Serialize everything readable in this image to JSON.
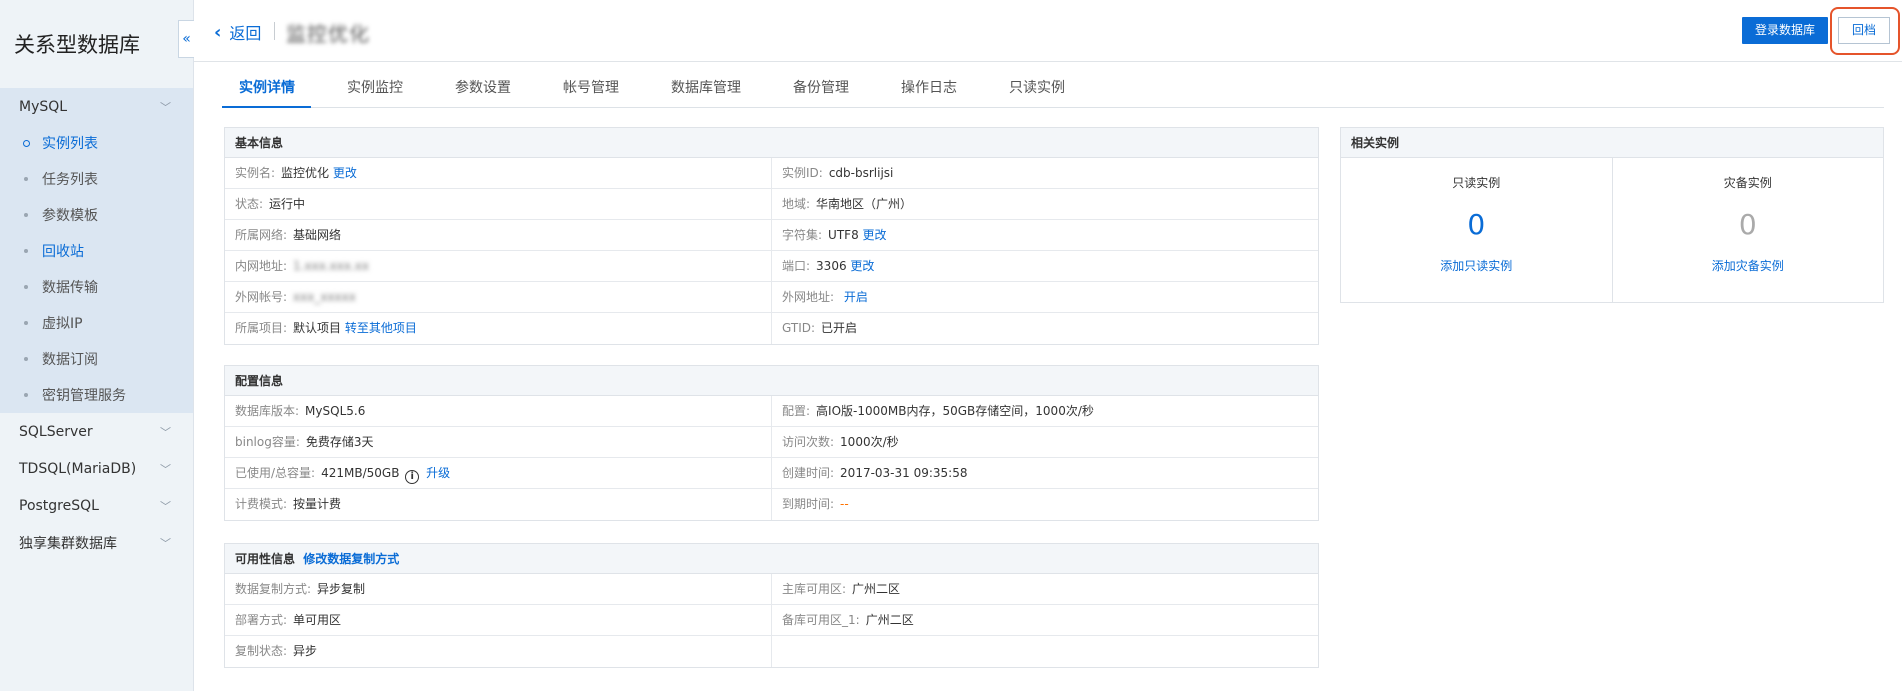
{
  "sidebar": {
    "title": "关系型数据库",
    "collapse_icon": "«",
    "groups": [
      {
        "label": "MySQL",
        "items": [
          "实例列表",
          "任务列表",
          "参数模板",
          "回收站",
          "数据传输",
          "虚拟IP",
          "数据订阅",
          "密钥管理服务"
        ]
      },
      {
        "label": "SQLServer"
      },
      {
        "label": "TDSQL(MariaDB)"
      },
      {
        "label": "PostgreSQL"
      },
      {
        "label": "独享集群数据库"
      }
    ]
  },
  "header": {
    "back": "返回",
    "instance_title": "监控优化",
    "login_button": "登录数据库",
    "archive_button": "回档"
  },
  "tabs": [
    "实例详情",
    "实例监控",
    "参数设置",
    "帐号管理",
    "数据库管理",
    "备份管理",
    "操作日志",
    "只读实例"
  ],
  "basic": {
    "title": "基本信息",
    "name_label": "实例名:",
    "name_value": "监控优化",
    "name_action": "更改",
    "id_label": "实例ID:",
    "id_value": "cdb-bsrlijsi",
    "status_label": "状态:",
    "status_value": "运行中",
    "region_label": "地域:",
    "region_value": "华南地区（广州）",
    "network_label": "所属网络:",
    "network_value": "基础网络",
    "charset_label": "字符集:",
    "charset_value": "UTF8",
    "charset_action": "更改",
    "ip_label": "内网地址:",
    "ip_value": "1.xxx.xxx.xx",
    "port_label": "端口:",
    "port_value": "3306",
    "port_action": "更改",
    "ext_account_label": "外网帐号:",
    "ext_account_value": "xxx_xxxxx",
    "ext_addr_label": "外网地址:",
    "ext_addr_action": "开启",
    "project_label": "所属项目:",
    "project_value": "默认项目",
    "project_action": "转至其他项目",
    "gtid_label": "GTID:",
    "gtid_value": "已开启"
  },
  "config": {
    "title": "配置信息",
    "version_label": "数据库版本:",
    "version_value": "MySQL5.6",
    "spec_label": "配置:",
    "spec_value": "高IO版-1000MB内存，50GB存储空间，1000次/秒",
    "binlog_label": "binlog容量:",
    "binlog_value": "免费存储3天",
    "qps_label": "访问次数:",
    "qps_value": "1000次/秒",
    "usage_label": "已使用/总容量:",
    "usage_value": "421MB/50GB",
    "usage_icon": "i",
    "usage_action": "升级",
    "created_label": "创建时间:",
    "created_value": "2017-03-31 09:35:58",
    "billing_label": "计费模式:",
    "billing_value": "按量计费",
    "expire_label": "到期时间:",
    "expire_value": "--"
  },
  "availability": {
    "title": "可用性信息",
    "title_action": "修改数据复制方式",
    "repl_mode_label": "数据复制方式:",
    "repl_mode_value": "异步复制",
    "master_zone_label": "主库可用区:",
    "master_zone_value": "广州二区",
    "deploy_label": "部署方式:",
    "deploy_value": "单可用区",
    "backup_zone_label": "备库可用区_1:",
    "backup_zone_value": "广州二区",
    "repl_status_label": "复制状态:",
    "repl_status_value": "异步"
  },
  "related": {
    "title": "相关实例",
    "readonly_title": "只读实例",
    "readonly_count": "0",
    "readonly_action": "添加只读实例",
    "dr_title": "灾备实例",
    "dr_count": "0",
    "dr_action": "添加灾备实例"
  },
  "colors": {
    "accent": "#0a6cd6",
    "highlight": "#e5542b",
    "expire": "#ff7200"
  }
}
